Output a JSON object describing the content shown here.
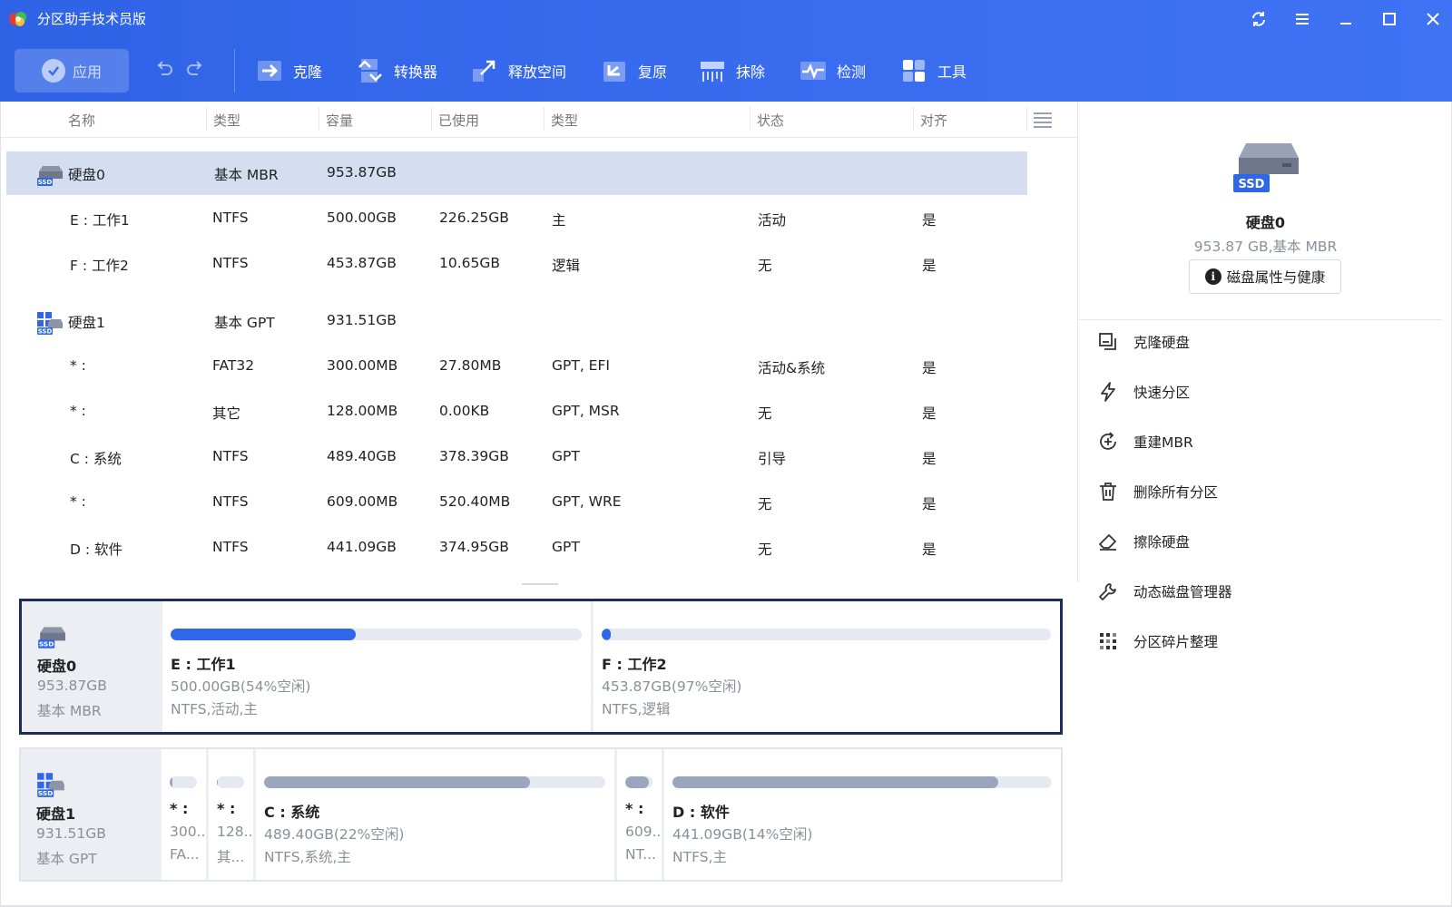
{
  "app": {
    "title": "分区助手技术员版"
  },
  "toolbar": {
    "apply_label": "应用",
    "tools": [
      {
        "label": "克隆",
        "icon": "clone-icon"
      },
      {
        "label": "转换器",
        "icon": "convert-icon"
      },
      {
        "label": "释放空间",
        "icon": "free-space-icon"
      },
      {
        "label": "复原",
        "icon": "restore-icon"
      },
      {
        "label": "抹除",
        "icon": "wipe-icon"
      },
      {
        "label": "检测",
        "icon": "check-icon"
      },
      {
        "label": "工具",
        "icon": "tools-icon"
      }
    ]
  },
  "table": {
    "headers": [
      "名称",
      "类型",
      "容量",
      "已使用",
      "类型",
      "状态",
      "对齐"
    ],
    "rows": [
      {
        "kind": "disk",
        "name": "硬盘0",
        "type": "基本 MBR",
        "capacity": "953.87GB",
        "used": "",
        "ptype": "",
        "status": "",
        "align": "",
        "selected": true
      },
      {
        "kind": "part",
        "name": "E : 工作1",
        "type": "NTFS",
        "capacity": "500.00GB",
        "used": "226.25GB",
        "ptype": "主",
        "status": "活动",
        "align": "是"
      },
      {
        "kind": "part",
        "name": "F : 工作2",
        "type": "NTFS",
        "capacity": "453.87GB",
        "used": "10.65GB",
        "ptype": "逻辑",
        "status": "无",
        "align": "是"
      },
      {
        "kind": "disk",
        "name": "硬盘1",
        "type": "基本 GPT",
        "capacity": "931.51GB",
        "used": "",
        "ptype": "",
        "status": "",
        "align": ""
      },
      {
        "kind": "part",
        "name": "* :",
        "type": "FAT32",
        "capacity": "300.00MB",
        "used": "27.80MB",
        "ptype": "GPT, EFI",
        "status": "活动&系统",
        "align": "是"
      },
      {
        "kind": "part",
        "name": "* :",
        "type": "其它",
        "capacity": "128.00MB",
        "used": "0.00KB",
        "ptype": "GPT, MSR",
        "status": "无",
        "align": "是"
      },
      {
        "kind": "part",
        "name": "C : 系统",
        "type": "NTFS",
        "capacity": "489.40GB",
        "used": "378.39GB",
        "ptype": "GPT",
        "status": "引导",
        "align": "是"
      },
      {
        "kind": "part",
        "name": "* :",
        "type": "NTFS",
        "capacity": "609.00MB",
        "used": "520.40MB",
        "ptype": "GPT, WRE",
        "status": "无",
        "align": "是"
      },
      {
        "kind": "part",
        "name": "D : 软件",
        "type": "NTFS",
        "capacity": "441.09GB",
        "used": "374.95GB",
        "ptype": "GPT",
        "status": "无",
        "align": "是"
      }
    ]
  },
  "diskmaps": [
    {
      "name": "硬盘0",
      "size": "953.87GB",
      "type": "基本 MBR",
      "partitions": [
        {
          "name": "E : 工作1",
          "size": "500.00GB(54%空闲)",
          "fs": "NTFS,活动,主",
          "used_fraction": 0.45,
          "color": "#2f67ea"
        },
        {
          "name": "F : 工作2",
          "size": "453.87GB(97%空闲)",
          "fs": "NTFS,逻辑",
          "used_fraction": 0.02,
          "color": "#2f67ea"
        }
      ]
    },
    {
      "name": "硬盘1",
      "size": "931.51GB",
      "type": "基本 GPT",
      "partitions": [
        {
          "name": "* :",
          "size": "300...",
          "fs": "FA...",
          "used_fraction": 0.1,
          "color": "#9aa6bd"
        },
        {
          "name": "* :",
          "size": "128...",
          "fs": "其...",
          "used_fraction": 0.0,
          "color": "#9aa6bd"
        },
        {
          "name": "C : 系统",
          "size": "489.40GB(22%空闲)",
          "fs": "NTFS,系统,主",
          "used_fraction": 0.78,
          "color": "#9aa6bd"
        },
        {
          "name": "* :",
          "size": "609...",
          "fs": "NT...",
          "used_fraction": 0.85,
          "color": "#9aa6bd"
        },
        {
          "name": "D : 软件",
          "size": "441.09GB(14%空闲)",
          "fs": "NTFS,主",
          "used_fraction": 0.86,
          "color": "#9aa6bd"
        }
      ]
    }
  ],
  "right_panel": {
    "disk_name": "硬盘0",
    "disk_info": "953.87 GB,基本 MBR",
    "health_button": "磁盘属性与健康",
    "ssd_badge": "SSD",
    "operations": [
      {
        "label": "克隆硬盘",
        "icon": "clone-disk-icon"
      },
      {
        "label": "快速分区",
        "icon": "quick-partition-icon"
      },
      {
        "label": "重建MBR",
        "icon": "rebuild-mbr-icon"
      },
      {
        "label": "删除所有分区",
        "icon": "trash-icon"
      },
      {
        "label": "擦除硬盘",
        "icon": "eraser-icon"
      },
      {
        "label": "动态磁盘管理器",
        "icon": "wrench-icon"
      },
      {
        "label": "分区碎片整理",
        "icon": "defrag-icon"
      }
    ]
  },
  "colors": {
    "accent": "#3a6cf0",
    "selected_row": "#d4def0",
    "active_map_border": "#1c2d57"
  }
}
